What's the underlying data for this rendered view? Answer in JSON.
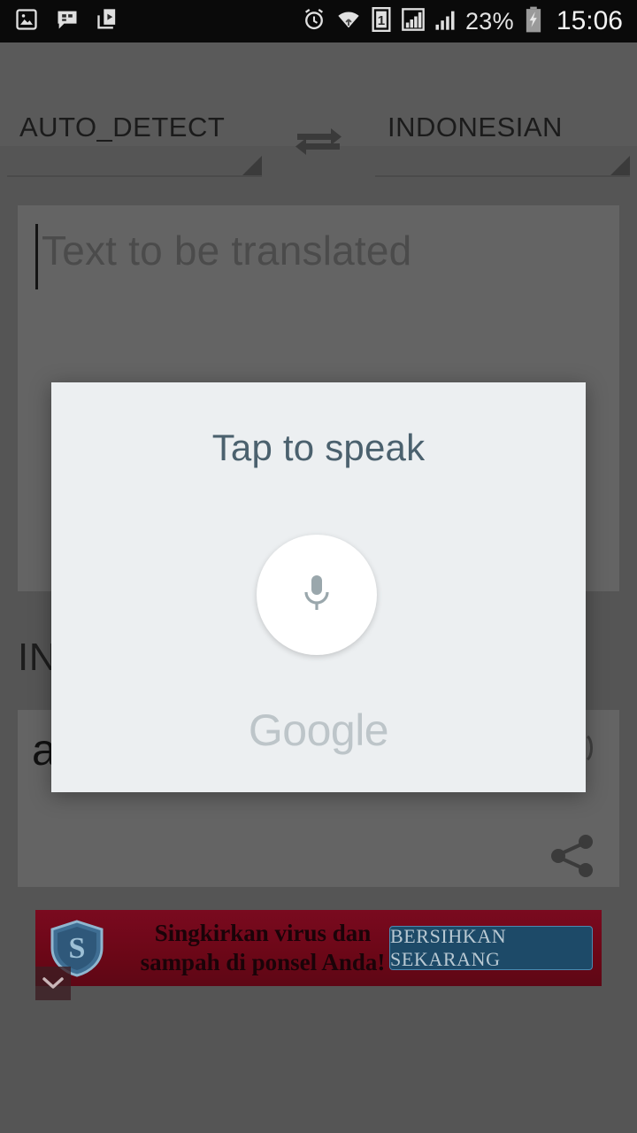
{
  "status_bar": {
    "left_icons": [
      {
        "name": "gallery-image-icon"
      },
      {
        "name": "messenger-chat-icon"
      },
      {
        "name": "play-store-download-icon"
      }
    ],
    "right_icons": [
      {
        "name": "alarm-clock-icon"
      },
      {
        "name": "wifi-icon"
      },
      {
        "name": "sim-1-icon",
        "label": "1"
      },
      {
        "name": "signal-bars-1-icon"
      },
      {
        "name": "signal-bars-2-icon"
      },
      {
        "name": "battery-charging-icon"
      }
    ],
    "battery_percent": "23%",
    "clock": "15:06"
  },
  "language_bar": {
    "source_language": "AUTO_DETECT",
    "target_language": "INDONESIAN",
    "swap_icon": "swap-horizontal-icon"
  },
  "input_area": {
    "placeholder": "Text to be translated",
    "value": ""
  },
  "result_area": {
    "target_language_heading": "INDONESIAN",
    "translated_text": "a",
    "speaker_icon": "volume-speaker-icon",
    "share_icon": "share-icon"
  },
  "voice_dialog": {
    "title": "Tap to speak",
    "mic_icon": "microphone-icon",
    "brand": "Google",
    "background_color": "#eceff1",
    "title_color": "#4b616e",
    "brand_color": "#bdc5c9"
  },
  "ad_banner": {
    "headline": "Singkirkan virus dan sampah di ponsel Anda!",
    "cta_label": "BERSIHKAN SEKARANG",
    "logo_icon": "shield-s-icon",
    "collapse_icon": "chevron-down-icon",
    "background_color": "#6d0a1c",
    "cta_color": "#1d4a68"
  },
  "theme": {
    "scrim_color": "#555555",
    "card_color": "#646464",
    "bar_color": "#5a5a5a",
    "status_bar_color": "#0a0a0a"
  }
}
